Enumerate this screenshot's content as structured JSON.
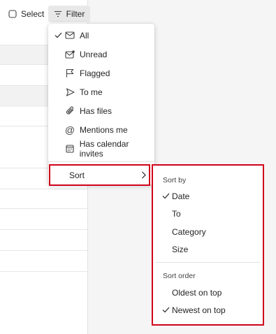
{
  "toolbar": {
    "select_label": "Select",
    "filter_label": "Filter"
  },
  "filter_menu": {
    "items": [
      {
        "label": "All",
        "icon": "envelope-icon",
        "checked": true
      },
      {
        "label": "Unread",
        "icon": "unread-envelope-icon",
        "checked": false
      },
      {
        "label": "Flagged",
        "icon": "flag-icon",
        "checked": false
      },
      {
        "label": "To me",
        "icon": "send-arrow-icon",
        "checked": false
      },
      {
        "label": "Has files",
        "icon": "paperclip-icon",
        "checked": false
      },
      {
        "label": "Mentions me",
        "icon": "at-sign-icon",
        "checked": false
      },
      {
        "label": "Has calendar invites",
        "icon": "calendar-icon",
        "checked": false
      }
    ],
    "sort_label": "Sort"
  },
  "sort_menu": {
    "sort_by_heading": "Sort by",
    "sort_by_options": [
      {
        "label": "Date",
        "checked": true
      },
      {
        "label": "To",
        "checked": false
      },
      {
        "label": "Category",
        "checked": false
      },
      {
        "label": "Size",
        "checked": false
      }
    ],
    "sort_order_heading": "Sort order",
    "sort_order_options": [
      {
        "label": "Oldest on top",
        "checked": false
      },
      {
        "label": "Newest on top",
        "checked": true
      }
    ]
  },
  "colors": {
    "highlight_border": "#d0021b",
    "filter_button_bg": "#e8e8e8",
    "pane_bg": "#f5f5f5"
  }
}
